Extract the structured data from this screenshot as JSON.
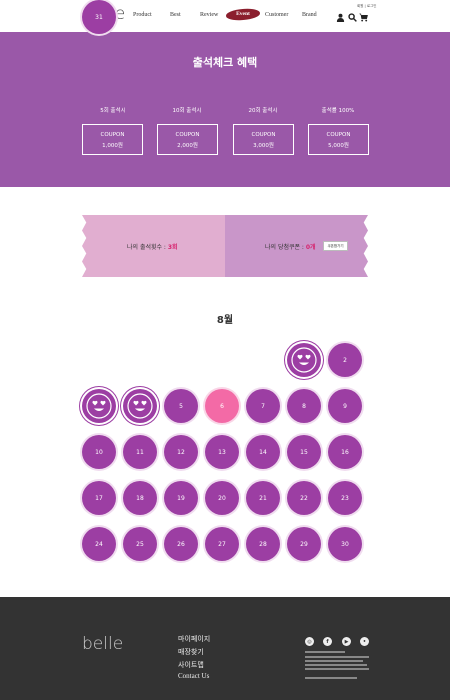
{
  "header": {
    "logo": "belle",
    "nav": [
      "Product",
      "Best",
      "Review",
      "Event",
      "Customer",
      "Brand"
    ],
    "toplinks": "회원 | 로그인"
  },
  "hero": {
    "title": "출석체크 혜택",
    "benefits": [
      {
        "label": "5회 출석시",
        "coupon": "COUPON",
        "amount": "1,000원"
      },
      {
        "label": "10회 출석시",
        "coupon": "COUPON",
        "amount": "2,000원"
      },
      {
        "label": "20회 출석시",
        "coupon": "COUPON",
        "amount": "3,000원"
      },
      {
        "label": "출석률 100%",
        "coupon": "COUPON",
        "amount": "5,000원"
      }
    ]
  },
  "status": {
    "attendance_label": "나의 출석횟수 : ",
    "attendance_value": "3회",
    "coupon_label": "나의 당첨쿠폰 : ",
    "coupon_value": "0개",
    "coupon_button": "쿠폰함가기"
  },
  "calendar": {
    "month": "8월",
    "today": "6",
    "stamped_days": [
      "1",
      "3",
      "4"
    ],
    "days": [
      "1",
      "2",
      "3",
      "4",
      "5",
      "6",
      "7",
      "8",
      "9",
      "10",
      "11",
      "12",
      "13",
      "14",
      "15",
      "16",
      "17",
      "18",
      "19",
      "20",
      "21",
      "22",
      "23",
      "24",
      "25",
      "26",
      "27",
      "28",
      "29",
      "30",
      "31"
    ]
  },
  "footer": {
    "logo": "belle",
    "links": [
      "마이페이지",
      "매장찾기",
      "사이트맵",
      "Contact Us"
    ]
  }
}
